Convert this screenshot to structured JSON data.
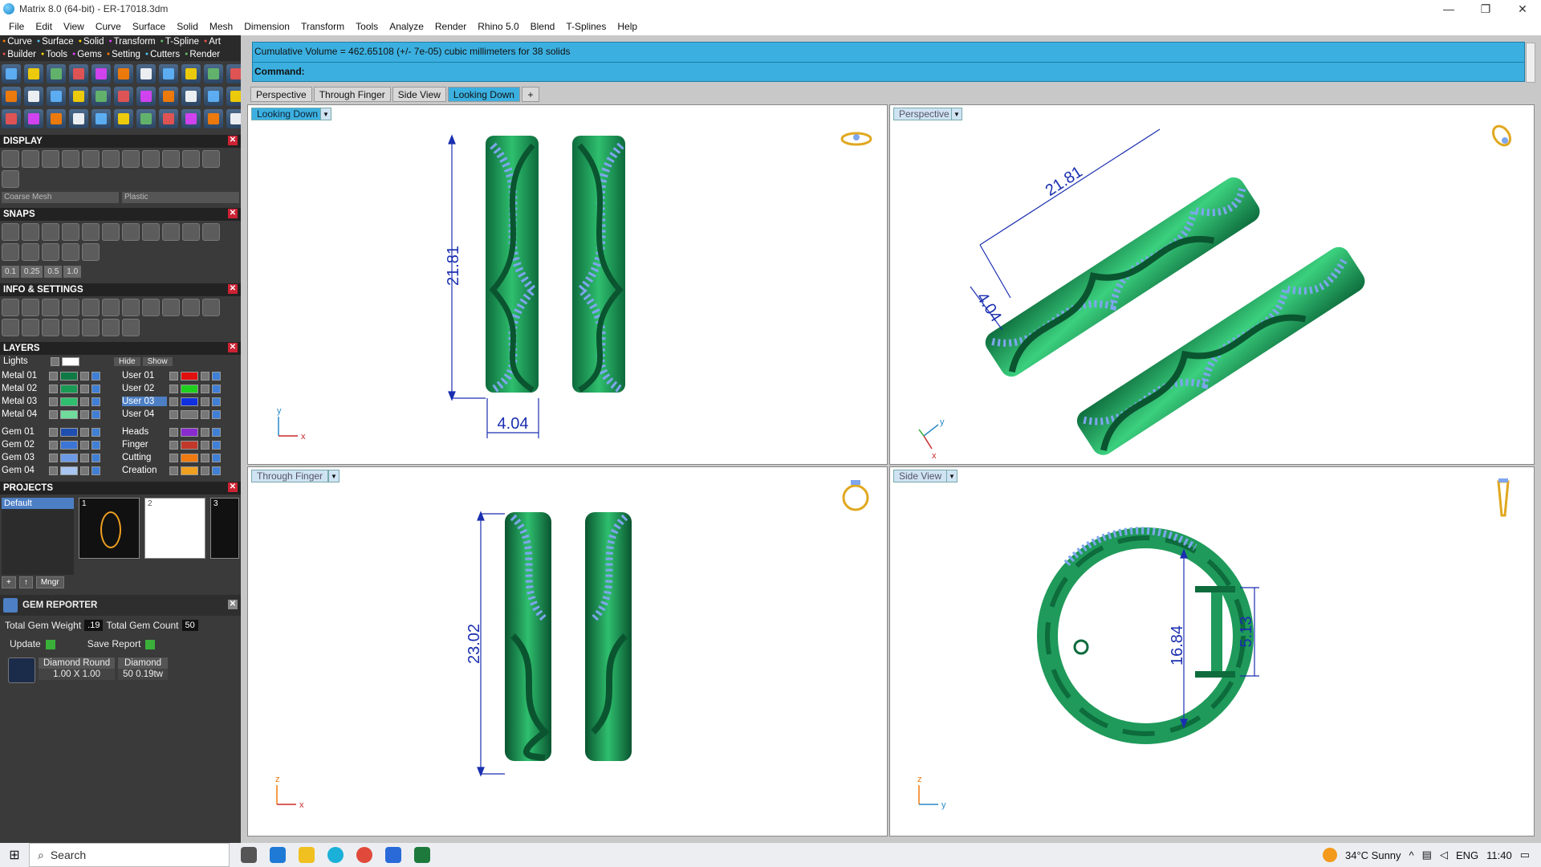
{
  "window": {
    "title": "Matrix 8.0 (64-bit) - ER-17018.3dm",
    "minimize": "—",
    "restore": "❐",
    "close": "✕"
  },
  "menu": [
    "File",
    "Edit",
    "View",
    "Curve",
    "Surface",
    "Solid",
    "Mesh",
    "Dimension",
    "Transform",
    "Tools",
    "Analyze",
    "Render",
    "Rhino 5.0",
    "Blend",
    "T-Splines",
    "Help"
  ],
  "sidebar": {
    "tabs_row1": [
      "Curve",
      "Surface",
      "Solid",
      "Transform",
      "T-Spline",
      "Art"
    ],
    "tabs_row2": [
      "Builder",
      "Tools",
      "Gems",
      "Setting",
      "Cutters",
      "Render"
    ],
    "display": {
      "title": "DISPLAY",
      "mesh": "Coarse Mesh",
      "material": "Plastic"
    },
    "snaps": {
      "title": "SNAPS",
      "values": [
        "0.1",
        "0.25",
        "0.5",
        "1.0"
      ]
    },
    "info": {
      "title": "INFO & SETTINGS"
    },
    "layers": {
      "title": "LAYERS",
      "lights": "Lights",
      "hide": "Hide",
      "show": "Show",
      "left": [
        {
          "name": "Metal 01",
          "color": "#0f7a45"
        },
        {
          "name": "Metal 02",
          "color": "#1a9a55"
        },
        {
          "name": "Metal 03",
          "color": "#2fbf6e"
        },
        {
          "name": "Metal 04",
          "color": "#6fdc9c"
        },
        {
          "name": "Gem 01",
          "color": "#1e4fb0"
        },
        {
          "name": "Gem 02",
          "color": "#3b76d6"
        },
        {
          "name": "Gem 03",
          "color": "#6c9ae6"
        },
        {
          "name": "Gem 04",
          "color": "#a8c4f0"
        }
      ],
      "right": [
        {
          "name": "User 01",
          "color": "#e01010"
        },
        {
          "name": "User 02",
          "color": "#1fd01f"
        },
        {
          "name": "User 03",
          "color": "#1030e0",
          "selected": true
        },
        {
          "name": "User 04",
          "color": "#777777"
        },
        {
          "name": "Heads",
          "color": "#8a2bd0"
        },
        {
          "name": "Finger",
          "color": "#c0392b"
        },
        {
          "name": "Cutting",
          "color": "#f07a10"
        },
        {
          "name": "Creation",
          "color": "#f0a020"
        }
      ]
    },
    "projects": {
      "title": "PROJECTS",
      "selected": "Default",
      "thumbs": [
        "1",
        "2",
        "3"
      ],
      "mngr": "Mngr"
    },
    "gem_reporter": {
      "title": "GEM REPORTER",
      "weight_label": "Total Gem Weight",
      "weight_value": ".19",
      "count_label": "Total Gem Count",
      "count_value": "50",
      "update": "Update",
      "save": "Save Report",
      "col1_header": "Diamond Round",
      "col2_header": "Diamond",
      "size": "1.00 X 1.00",
      "count": "50",
      "ctw": "0.19tw"
    }
  },
  "command": {
    "history": "Cumulative Volume = 462.65108 (+/- 7e-05) cubic millimeters for 38 solids",
    "prompt": "Command:",
    "value": ""
  },
  "viewport_tabs": [
    {
      "label": "Perspective",
      "active": false
    },
    {
      "label": "Through Finger",
      "active": false
    },
    {
      "label": "Side View",
      "active": false
    },
    {
      "label": "Looking Down",
      "active": true
    }
  ],
  "viewports": {
    "top_left": {
      "label": "Looking Down",
      "dims": {
        "height": "21.81",
        "width": "4.04"
      },
      "axes": [
        "y",
        "x"
      ]
    },
    "top_right": {
      "label": "Perspective",
      "dims": {
        "length": "21.81",
        "width": "4.04"
      },
      "axes": [
        "y",
        "x"
      ]
    },
    "bottom_left": {
      "label": "Through Finger",
      "dims": {
        "height": "23.02"
      },
      "axes": [
        "z",
        "x"
      ]
    },
    "bottom_right": {
      "label": "Side View",
      "dims": {
        "diameter": "16.84",
        "gap": "5.13"
      },
      "axes": [
        "z",
        "y"
      ]
    }
  },
  "colors": {
    "accent": "#3bb0e0",
    "metal_dark": "#0d6b3c",
    "metal_mid": "#1f9a5a",
    "metal_light": "#5fd08c",
    "gem": "#7ea6ee",
    "dim": "#1a2fb0"
  },
  "taskbar": {
    "search": "Search",
    "weather": "34°C  Sunny",
    "lang": "ENG",
    "time": "11:40"
  }
}
